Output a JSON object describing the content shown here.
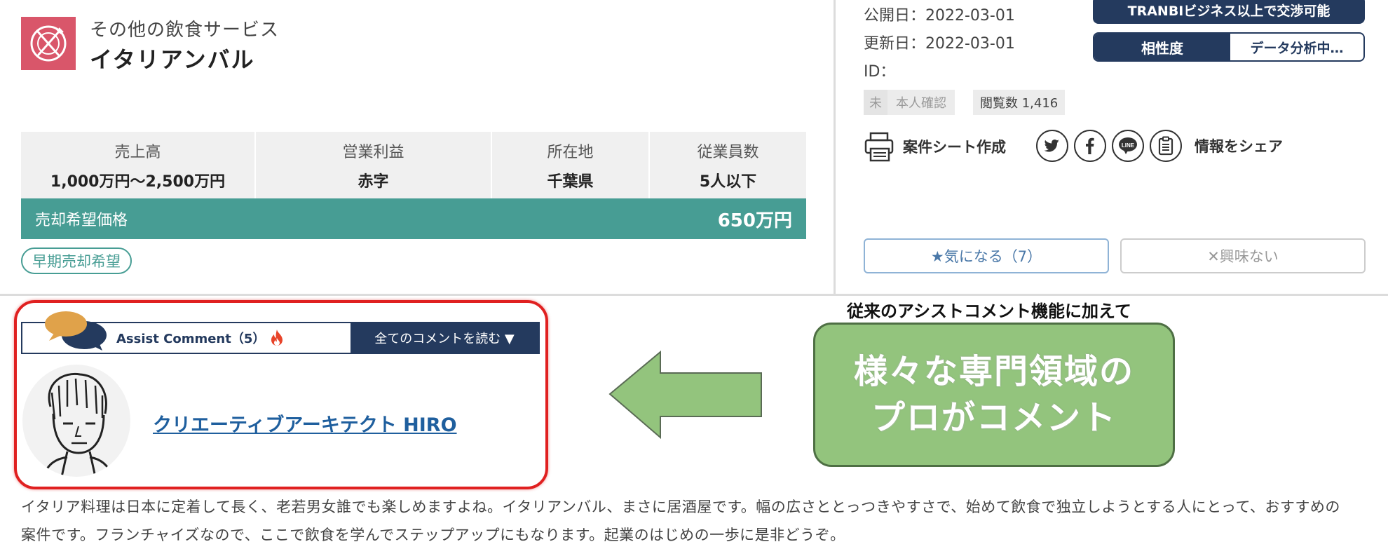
{
  "category": {
    "subtitle": "その他の飲食サービス",
    "title": "イタリアンバル",
    "icon": "fork-knife-plate-icon",
    "icon_color": "#d9566a"
  },
  "stats": [
    {
      "label": "売上高",
      "value": "1,000万円〜2,500万円"
    },
    {
      "label": "営業利益",
      "value": "赤字"
    },
    {
      "label": "所在地",
      "value": "千葉県"
    },
    {
      "label": "従業員数",
      "value": "5人以下"
    }
  ],
  "price": {
    "label": "売却希望価格",
    "value": "650万円",
    "color": "#479d94"
  },
  "tag": "早期売却希望",
  "meta": {
    "published": "公開日：2022-03-01",
    "updated": "更新日：2022-03-01",
    "id": "ID："
  },
  "badges": {
    "verify_mark": "未",
    "verify_label": "本人確認",
    "views": "閲覧数 1,416"
  },
  "actions": {
    "sheet": "案件シート作成",
    "share": "情報をシェア",
    "social_icons": [
      "twitter-icon",
      "facebook-icon",
      "line-icon",
      "clipboard-icon"
    ]
  },
  "tranbi": "TRANBIビジネス以上で交渉可能",
  "compat": {
    "label": "相性度",
    "status": "データ分析中…"
  },
  "buttons": {
    "favorite": "★気になる（7）",
    "not_interested": "✕興味ない"
  },
  "assist": {
    "title": "Assist Comment（5）",
    "read_all": "全てのコメントを読む ▼",
    "commenter": "クリエーティブアーキテクト HIRO"
  },
  "annotation": {
    "caption": "従来のアシストコメント機能に加えて",
    "promo_line1": "様々な専門領域の",
    "promo_line2": "プロがコメント"
  },
  "description": "イタリア料理は日本に定着して長く、老若男女誰でも楽しめますよね。イタリアンバル、まさに居酒屋です。幅の広さととっつきやすさで、始めて飲食で独立しようとする人にとって、おすすめの案件です。フランチャイズなので、ここで飲食を学んでステップアップにもなります。起業のはじめの一歩に是非どうぞ。",
  "colors": {
    "navy": "#243a5e",
    "teal": "#479d94",
    "red_frame": "#e02020",
    "promo_green": "#93c47d"
  }
}
